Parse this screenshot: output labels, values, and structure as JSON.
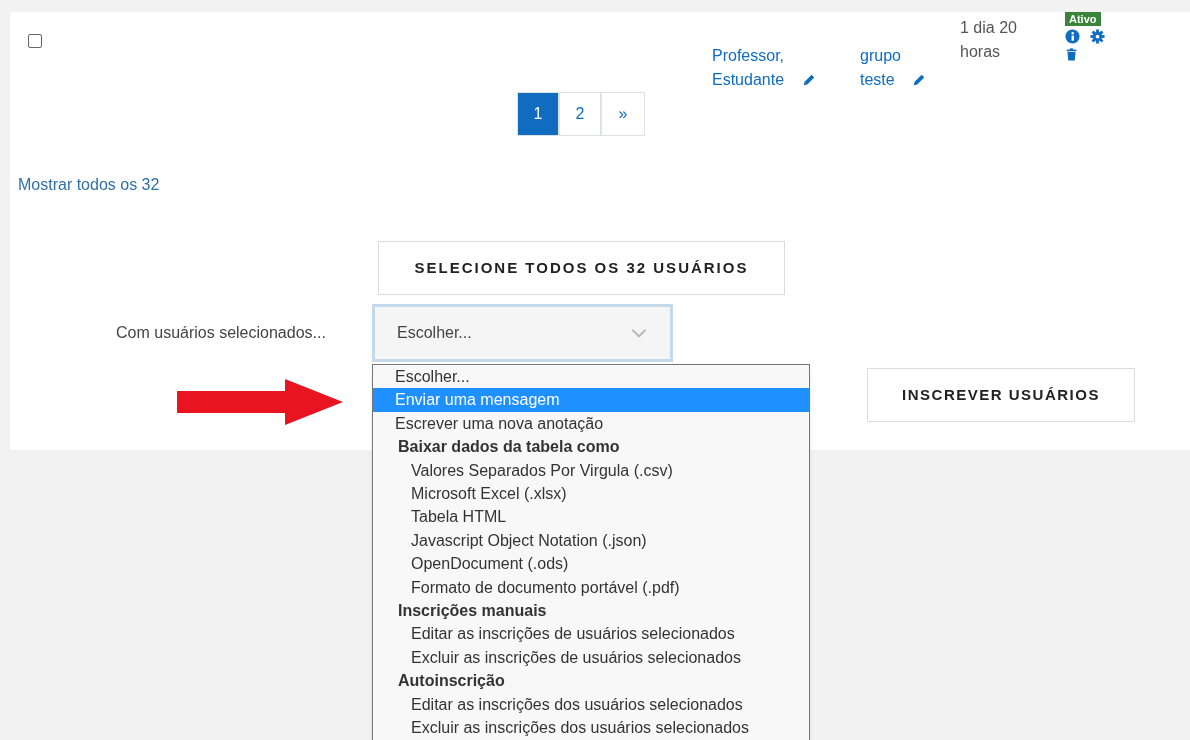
{
  "table_row": {
    "checked": false,
    "roles": "Professor, Estudante",
    "groups": "grupo teste",
    "time": "1 dia 20 horas",
    "status": "Ativo"
  },
  "pagination": [
    {
      "label": "1",
      "selected": true
    },
    {
      "label": "2",
      "selected": false
    },
    {
      "label": "»",
      "selected": false
    }
  ],
  "show_all_link": "Mostrar todos os 32",
  "select_all_button": "SELECIONE TODOS OS 32 USUÁRIOS",
  "bulk_action": {
    "label": "Com usuários selecionados...",
    "value": "Escolher...",
    "expanded": true
  },
  "enrol_button": "INSCREVER USUÁRIOS",
  "options": [
    {
      "kind": "option",
      "label": "Escolher...",
      "selected": false
    },
    {
      "kind": "option",
      "label": "Enviar uma mensagem",
      "selected": true
    },
    {
      "kind": "option",
      "label": "Escrever uma nova anotação",
      "selected": false
    },
    {
      "kind": "group",
      "label": "Baixar dados da tabela como",
      "children": [
        {
          "label": "Valores Separados Por Virgula (.csv)",
          "selected": false
        },
        {
          "label": "Microsoft Excel (.xlsx)",
          "selected": false
        },
        {
          "label": "Tabela HTML",
          "selected": false
        },
        {
          "label": "Javascript Object Notation (.json)",
          "selected": false
        },
        {
          "label": "OpenDocument (.ods)",
          "selected": false
        },
        {
          "label": "Formato de documento portável (.pdf)",
          "selected": false
        }
      ]
    },
    {
      "kind": "group",
      "label": "Inscrições manuais",
      "children": [
        {
          "label": "Editar as inscrições de usuários selecionados",
          "selected": false
        },
        {
          "label": "Excluir as inscrições de usuários selecionados",
          "selected": false
        }
      ]
    },
    {
      "kind": "group",
      "label": "Autoinscrição",
      "children": [
        {
          "label": "Editar as inscrições dos usuários selecionados",
          "selected": false
        },
        {
          "label": "Excluir as inscrições dos usuários selecionados",
          "selected": false
        }
      ]
    }
  ]
}
